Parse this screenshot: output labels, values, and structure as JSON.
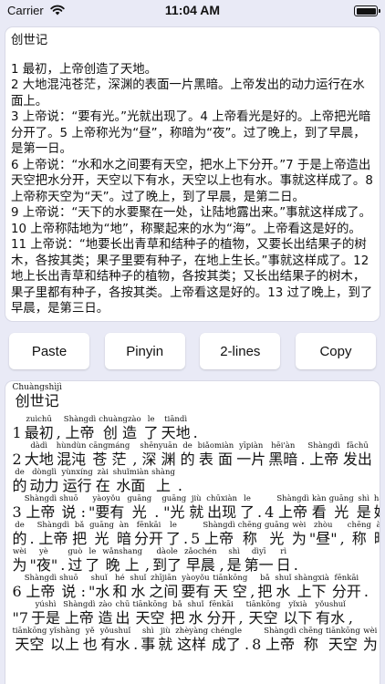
{
  "status_bar": {
    "carrier": "Carrier",
    "time": "11:04 AM"
  },
  "source": {
    "title": "创世记",
    "paragraphs": [
      "1 最初，上帝创造了天地。",
      "2 大地混沌苍茫，深渊的表面一片黑暗。上帝发出的动力运行在水面上。",
      "3 上帝说：“要有光。”光就出现了。4 上帝看光是好的。上帝把光暗分开了。5 上帝称光为“昼”，称暗为“夜”。过了晚上，到了早晨，是第一日。",
      "6 上帝说：“水和水之间要有天空，把水上下分开。”7 于是上帝造出天空把水分开，天空以下有水，天空以上也有水。事就这样成了。8 上帝称天空为“天”。过了晚上，到了早晨，是第二日。",
      "9 上帝说：“天下的水要聚在一处，让陆地露出来。”事就这样成了。10 上帝称陆地为“地”，称聚起来的水为“海”。上帝看这是好的。11 上帝说：“地要长出青草和结种子的植物，又要长出结果子的树木，各按其类；果子里要有种子，在地上生长。”事就这样成了。12 地上长出青草和结种子的植物，各按其类；又长出结果子的树木，果子里都有种子，各按其类。上帝看这是好的。13 过了晚上，到了早晨，是第三日。"
    ]
  },
  "buttons": {
    "paste": "Paste",
    "pinyin": "Pinyin",
    "two_lines": "2-lines",
    "copy": "Copy"
  },
  "pinyin_view": {
    "title": [
      [
        "Chuàngshìjì",
        "创世记"
      ]
    ],
    "lines": [
      [
        [
          "",
          "1"
        ],
        [
          "zuìchū",
          "最初"
        ],
        [
          "",
          ","
        ],
        [
          "Shàngdì",
          "上帝"
        ],
        [
          "chuàngzào",
          "创 造"
        ],
        [
          "le",
          "了"
        ],
        [
          "tiāndì",
          "天地"
        ],
        [
          "",
          "."
        ]
      ],
      [
        [
          "",
          "2"
        ],
        [
          "dàdì",
          "大地"
        ],
        [
          "hùndùn",
          "混沌"
        ],
        [
          "cāngmáng",
          "苍 茫"
        ],
        [
          "",
          ","
        ],
        [
          "shēnyuān",
          "深 渊"
        ],
        [
          "de",
          "的"
        ],
        [
          "biǎomiàn",
          "表 面"
        ],
        [
          "yīpiàn",
          "一片"
        ],
        [
          "hēi'àn",
          "黑暗"
        ],
        [
          "",
          "."
        ],
        [
          "Shàngdì",
          "上帝"
        ],
        [
          "fāchū",
          "发出"
        ]
      ],
      [
        [
          "de",
          "的"
        ],
        [
          "dònglì",
          "动力"
        ],
        [
          "yùnxíng",
          "运行"
        ],
        [
          "zài",
          "在"
        ],
        [
          "shuǐmiàn",
          "水面"
        ],
        [
          "shàng",
          "上"
        ],
        [
          "",
          "."
        ]
      ],
      [
        [
          "",
          "3"
        ],
        [
          "Shàngdì",
          "上帝"
        ],
        [
          "shuō",
          "说"
        ],
        [
          "",
          ":"
        ],
        [
          "yàoyǒu",
          "\"要有"
        ],
        [
          "guāng",
          "光"
        ],
        [
          "",
          "."
        ],
        [
          "guāng",
          "\"光"
        ],
        [
          "jiù",
          "就"
        ],
        [
          "chūxiàn",
          "出现"
        ],
        [
          "le",
          "了"
        ],
        [
          "",
          "."
        ],
        [
          "",
          "4"
        ],
        [
          "Shàngdì",
          "上帝"
        ],
        [
          "kàn",
          "看"
        ],
        [
          "guāng",
          "光"
        ],
        [
          "shì",
          "是"
        ],
        [
          "hǎo",
          "好"
        ]
      ],
      [
        [
          "de",
          "的"
        ],
        [
          "",
          "."
        ],
        [
          "Shàngdì",
          "上帝"
        ],
        [
          "bǎ",
          "把"
        ],
        [
          "guāng",
          "光"
        ],
        [
          "àn",
          "暗"
        ],
        [
          "fēnkāi",
          "分开"
        ],
        [
          "le",
          "了"
        ],
        [
          "",
          "."
        ],
        [
          "",
          "5"
        ],
        [
          "Shàngdì",
          "上帝"
        ],
        [
          "chēng",
          "称"
        ],
        [
          "guāng",
          "光"
        ],
        [
          "wèi",
          "为"
        ],
        [
          "zhòu",
          "\"昼\""
        ],
        [
          "",
          ","
        ],
        [
          "chēng",
          "称"
        ],
        [
          "àn",
          "暗"
        ]
      ],
      [
        [
          "wèi",
          "为"
        ],
        [
          "yè",
          "\"夜\""
        ],
        [
          "",
          "."
        ],
        [
          "guò",
          "过"
        ],
        [
          "le",
          "了"
        ],
        [
          "wǎnshang",
          "晚 上"
        ],
        [
          "",
          ","
        ],
        [
          "dàole",
          "到了"
        ],
        [
          "zǎochén",
          "早晨"
        ],
        [
          "",
          ","
        ],
        [
          "shì",
          "是"
        ],
        [
          "dìyī",
          "第一"
        ],
        [
          "rì",
          "日"
        ],
        [
          "",
          "."
        ]
      ],
      [
        [
          "",
          "6"
        ],
        [
          "Shàngdì",
          "上帝"
        ],
        [
          "shuō",
          "说"
        ],
        [
          "",
          ":"
        ],
        [
          "shuǐ",
          "\"水"
        ],
        [
          "hé",
          "和"
        ],
        [
          "shuǐ",
          "水"
        ],
        [
          "zhījiān",
          "之间"
        ],
        [
          "yàoyǒu",
          "要有"
        ],
        [
          "tiānkōng",
          "天 空"
        ],
        [
          "",
          ","
        ],
        [
          "bǎ",
          "把"
        ],
        [
          "shuǐ",
          "水"
        ],
        [
          "shàngxià",
          "上下"
        ],
        [
          "fēnkāi",
          "分开"
        ],
        [
          "",
          "."
        ]
      ],
      [
        [
          "",
          "\"7"
        ],
        [
          "yúshì",
          "于是"
        ],
        [
          "Shàngdì",
          "上帝"
        ],
        [
          "zào",
          "造"
        ],
        [
          "chū",
          "出"
        ],
        [
          "tiānkōng",
          "天空"
        ],
        [
          "bǎ",
          "把"
        ],
        [
          "shuǐ",
          "水"
        ],
        [
          "fēnkāi",
          "分开"
        ],
        [
          "",
          ","
        ],
        [
          "tiānkōng",
          "天空"
        ],
        [
          "yǐxià",
          "以下"
        ],
        [
          "yǒushuǐ",
          "有水"
        ],
        [
          "",
          ","
        ]
      ],
      [
        [
          "tiānkōng",
          "天空"
        ],
        [
          "yǐshàng",
          "以上"
        ],
        [
          "yě",
          "也"
        ],
        [
          "yǒushuǐ",
          "有水"
        ],
        [
          "",
          "."
        ],
        [
          "shì",
          "事"
        ],
        [
          "jiù",
          "就"
        ],
        [
          "zhèyàng",
          "这样"
        ],
        [
          "chéngle",
          "成了"
        ],
        [
          "",
          "."
        ],
        [
          "",
          "8"
        ],
        [
          "Shàngdì",
          "上帝"
        ],
        [
          "chēng",
          "称"
        ],
        [
          "tiānkōng",
          "天空"
        ],
        [
          "wèi",
          "为"
        ]
      ]
    ]
  }
}
